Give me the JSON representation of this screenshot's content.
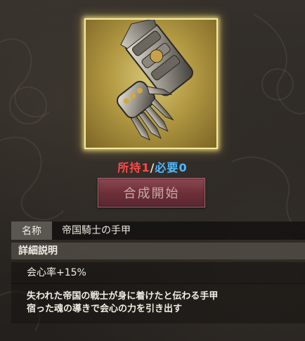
{
  "item": {
    "icon": "gauntlet-icon",
    "owned_label": "所持",
    "owned_count": "1",
    "separator": "/",
    "required_label": "必要",
    "required_count": "0"
  },
  "craft_button": {
    "label": "合成開始"
  },
  "info": {
    "name_label": "名称",
    "name_value": "帝国騎士の手甲",
    "detail_label": "詳細説明",
    "effect": "会心率+15%",
    "description_lines": [
      "失われた帝国の戦士が身に着けたと伝わる手甲",
      "宿った魂の導きで会心の力を引き出す"
    ]
  },
  "colors": {
    "owned": "#ff4a4a",
    "required": "#4fb8ff",
    "frame_glow": "#f6ec9a",
    "button": "#6e3039"
  }
}
